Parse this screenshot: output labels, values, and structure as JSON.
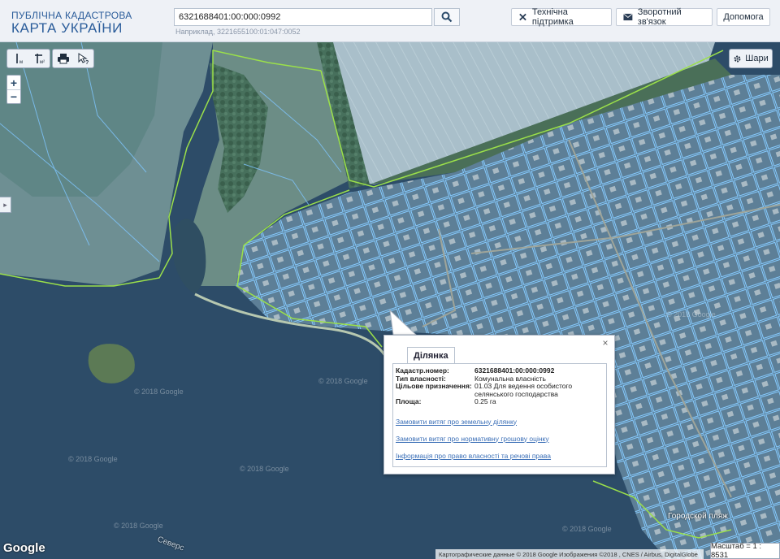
{
  "header": {
    "logo_line1": "ПУБЛІЧНА КАДАСТРОВА",
    "logo_line2": "КАРТА УКРАЇНИ",
    "search_value": "6321688401:00:000:0992",
    "search_hint": "Наприклад, 3221655100:01:047:0052",
    "buttons": [
      {
        "label": "Технічна підтримка",
        "icon": "tools-icon"
      },
      {
        "label": "Зворотний зв'язок",
        "icon": "envelope-icon"
      },
      {
        "label": "Допомога",
        "icon": ""
      }
    ]
  },
  "map": {
    "layers_label": "Шари",
    "zoom_in": "+",
    "zoom_out": "−",
    "side_tab": "▸",
    "scale_text": "Масштаб = 1 : 8531",
    "attribution": "Картографические данные © 2018 Google Изображения ©2018 , CNES / Airbus, DigitalGlobe",
    "google_logo": "Google",
    "place_label": "Городской пляж",
    "water_label": "Северс",
    "watermarks": [
      "© 2018 Google",
      "© 2018 Google",
      "© 2018 Google",
      "© 2018 Google",
      "© 2018 Google",
      "© 2018 Google",
      "© 2018 Google"
    ]
  },
  "popup": {
    "tab": "Ділянка",
    "close": "×",
    "rows": [
      {
        "label": "Кадастр.номер:",
        "value": "6321688401:00:000:0992"
      },
      {
        "label": "Тип власності:",
        "value": "Комунальна власність"
      },
      {
        "label": "Цільове призначення:",
        "value": "01.03 Для ведення особистого селянського господарства"
      },
      {
        "label": "Площа:",
        "value": "0.25 га"
      }
    ],
    "links": [
      "Замовити витяг про земельну ділянку",
      "Замовити витяг про нормативну грошову оцінку",
      "Інформація про право власності та речові права"
    ]
  },
  "colors": {
    "header_bg": "#eef1f6",
    "logo": "#2a5c9a",
    "water": "#2c4a66",
    "field": "#8aa6b8",
    "parcel_outline": "#7fc6ff",
    "boundary_green": "#9be04a",
    "link": "#3b6fb7"
  }
}
